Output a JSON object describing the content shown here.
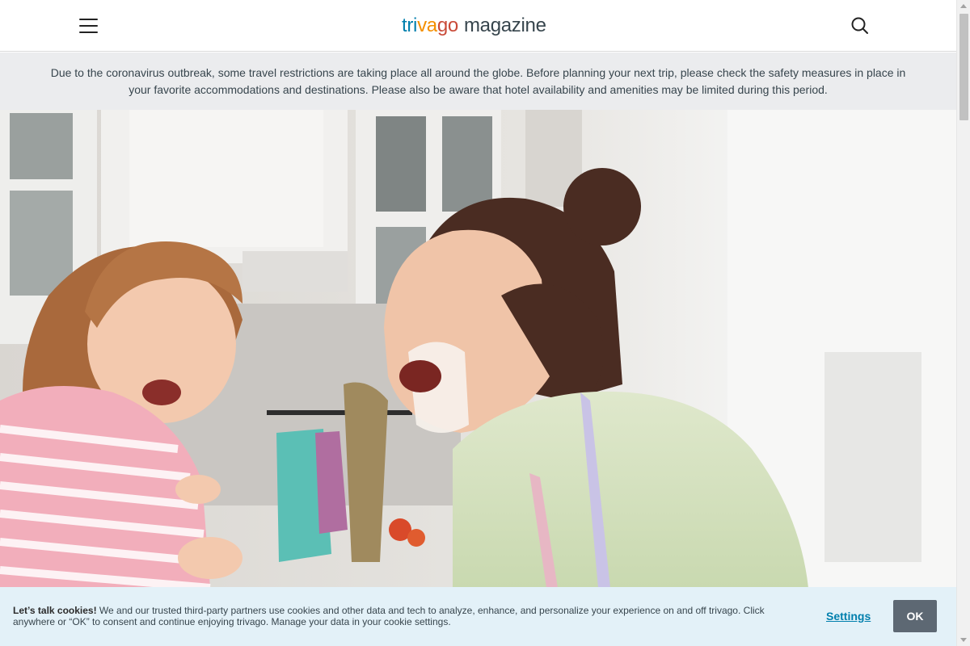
{
  "header": {
    "logo": {
      "part_tri": "tri",
      "part_va": "va",
      "part_go": "go",
      "suffix": "magazine"
    },
    "icons": {
      "menu": "hamburger-menu-icon",
      "search": "search-icon"
    }
  },
  "notice": {
    "text": "Due to the coronavirus outbreak, some travel restrictions are taking place all around the globe. Before planning your next trip, please check the safety measures in place in your favorite accommodations and destinations. Please also be aware that hotel availability and amenities may be limited during this period."
  },
  "hero": {
    "description_icon": "hero-photo"
  },
  "cookie_bar": {
    "heading": "Let’s talk cookies!",
    "body": " We and our trusted third-party partners use cookies and other data and tech to analyze, enhance, and personalize your experience on and off trivago. Click anywhere or “OK” to consent and continue enjoying trivago. Manage your data in your cookie settings.",
    "settings_label": "Settings",
    "ok_label": "OK"
  },
  "colors": {
    "logo_blue": "#007fad",
    "logo_orange": "#f48f00",
    "logo_red": "#c94a38",
    "notice_bg": "#ebecee",
    "cookie_bg": "#e3f1f8",
    "ok_button": "#5d6873",
    "link": "#007fad"
  }
}
